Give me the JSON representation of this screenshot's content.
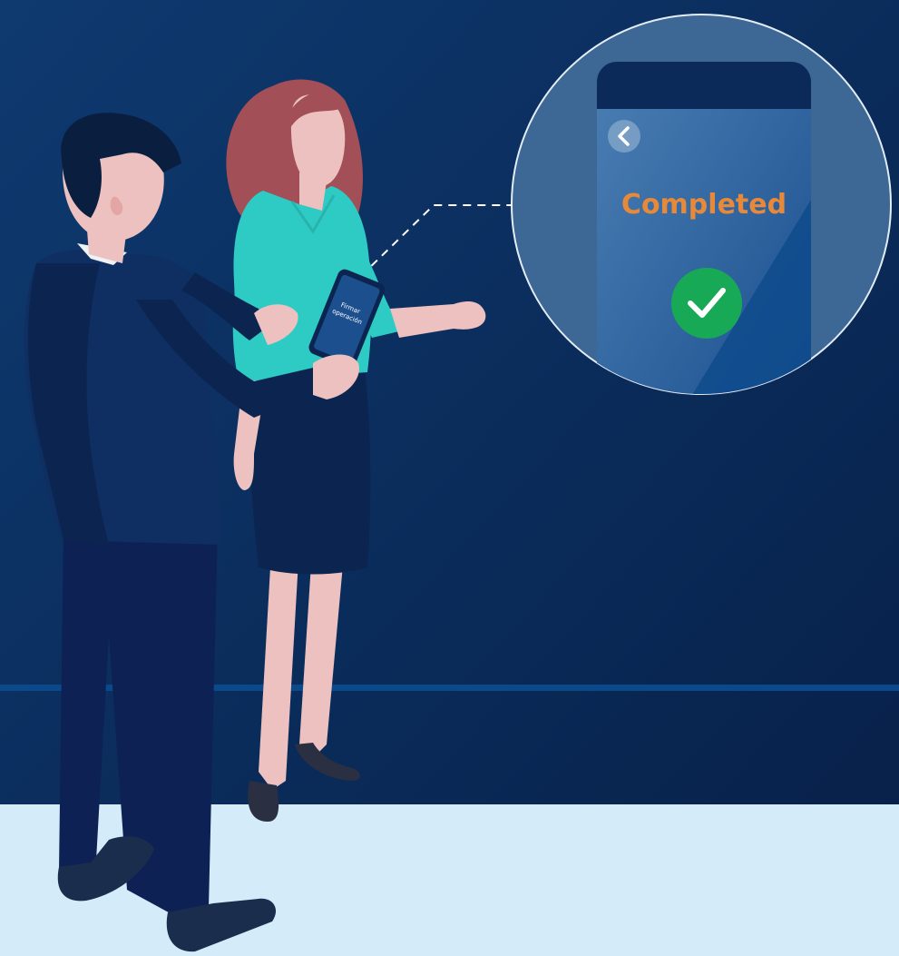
{
  "phone_zoom": {
    "status_label": "Completed",
    "back_icon": "chevron-left-icon",
    "status_icon": "check-circle-icon",
    "status_color": "#e8893a",
    "check_color": "#18a957"
  },
  "tablet": {
    "label_line1": "Firmar",
    "label_line2": "operación"
  },
  "colors": {
    "background": "#0b2a5a",
    "floor": "#d4ebfa",
    "wall_stripe": "#0a4a8a"
  }
}
